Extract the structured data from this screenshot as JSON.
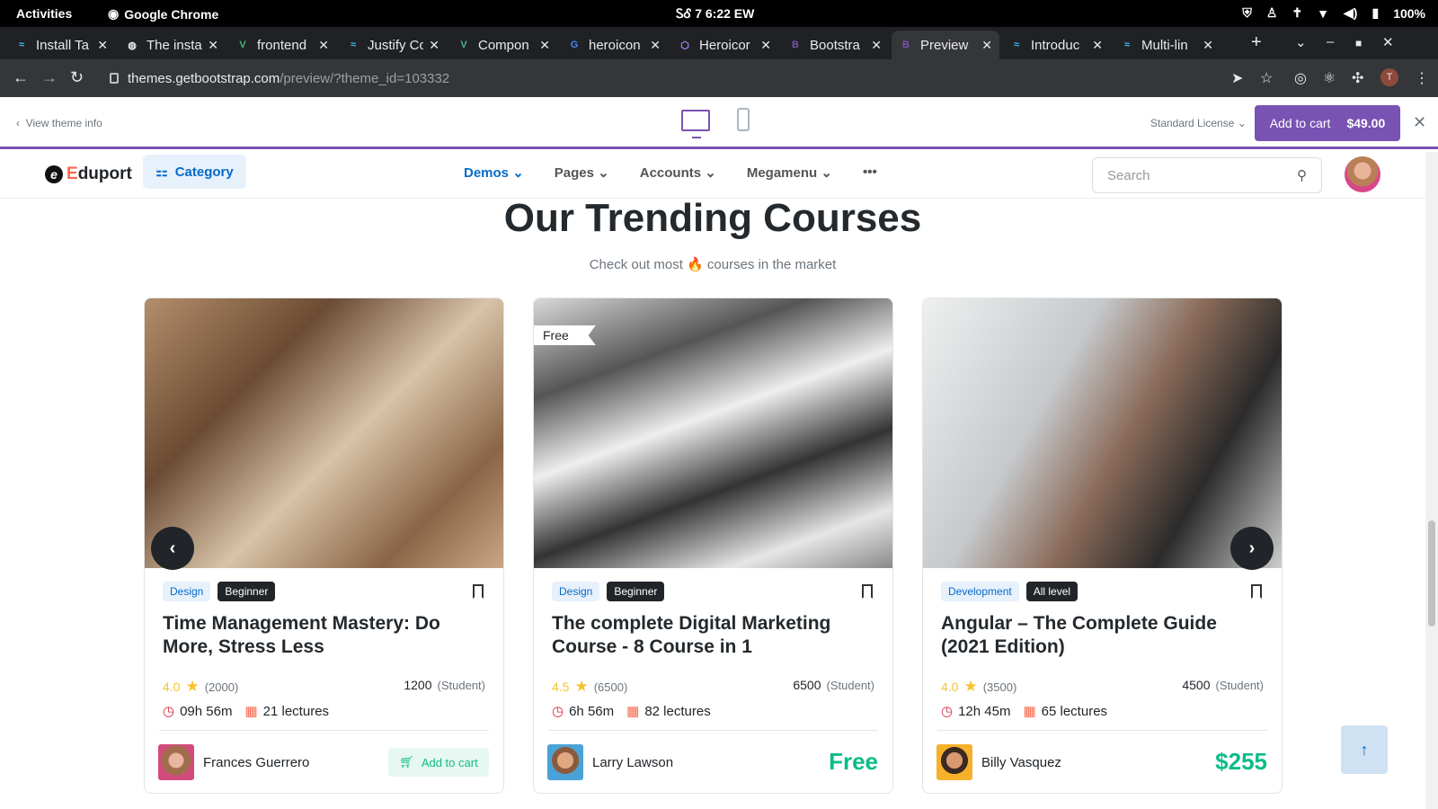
{
  "system_bar": {
    "activities": "Activities",
    "app": "Google Chrome",
    "clock": "ᏚᎴ 7  6:22 EW",
    "battery": "100%"
  },
  "tabs": [
    {
      "label": "Install Ta",
      "fav": "≈",
      "fav_color": "#38bdf8"
    },
    {
      "label": "The insta",
      "fav": "◍",
      "fav_color": "#e8eaed"
    },
    {
      "label": "frontend",
      "fav": "V",
      "fav_color": "#42b883"
    },
    {
      "label": "Justify Cc",
      "fav": "≈",
      "fav_color": "#38bdf8"
    },
    {
      "label": "Compon",
      "fav": "V",
      "fav_color": "#42b883"
    },
    {
      "label": "heroicon",
      "fav": "G",
      "fav_color": "#4285f4"
    },
    {
      "label": "Heroicor",
      "fav": "⬡",
      "fav_color": "#a78bfa"
    },
    {
      "label": "Bootstra",
      "fav": "B",
      "fav_color": "#7952b3"
    },
    {
      "label": "Preview",
      "fav": "B",
      "fav_color": "#7952b3"
    },
    {
      "label": "Introduc",
      "fav": "≈",
      "fav_color": "#38bdf8"
    },
    {
      "label": "Multi-lin",
      "fav": "≈",
      "fav_color": "#38bdf8"
    }
  ],
  "url": {
    "host": "themes.getbootstrap.com",
    "path": "/preview/?theme_id=103332"
  },
  "profile_initial": "T",
  "preview_bar": {
    "view_info": "View theme info",
    "license": "Standard License",
    "cart_label": "Add to cart",
    "cart_price": "$49.00"
  },
  "site": {
    "logo_e": "E",
    "logo_rest": "duport",
    "category": "Category",
    "nav": [
      "Demos",
      "Pages",
      "Accounts",
      "Megamenu"
    ],
    "more": "•••",
    "search_placeholder": "Search"
  },
  "section": {
    "title": "Our Trending Courses",
    "subtitle": "Check out most 🔥 courses in the market"
  },
  "courses": [
    {
      "tag1": "Design",
      "tag2": "Beginner",
      "title": "Time Management Mastery: Do More, Stress Less",
      "rating": "4.0",
      "reviews": "(2000)",
      "students": "1200",
      "students_label": "(Student)",
      "duration": "09h 56m",
      "lectures": "21 lectures",
      "author": "Frances Guerrero",
      "action": "Add to cart"
    },
    {
      "badge": "Free",
      "tag1": "Design",
      "tag2": "Beginner",
      "title": "The complete Digital Marketing Course - 8 Course in 1",
      "rating": "4.5",
      "reviews": "(6500)",
      "students": "6500",
      "students_label": "(Student)",
      "duration": "6h 56m",
      "lectures": "82 lectures",
      "author": "Larry Lawson",
      "price": "Free"
    },
    {
      "tag1": "Development",
      "tag2": "All level",
      "title": "Angular – The Complete Guide (2021 Edition)",
      "rating": "4.0",
      "reviews": "(3500)",
      "students": "4500",
      "students_label": "(Student)",
      "duration": "12h 45m",
      "lectures": "65 lectures",
      "author": "Billy Vasquez",
      "price": "$255"
    }
  ]
}
